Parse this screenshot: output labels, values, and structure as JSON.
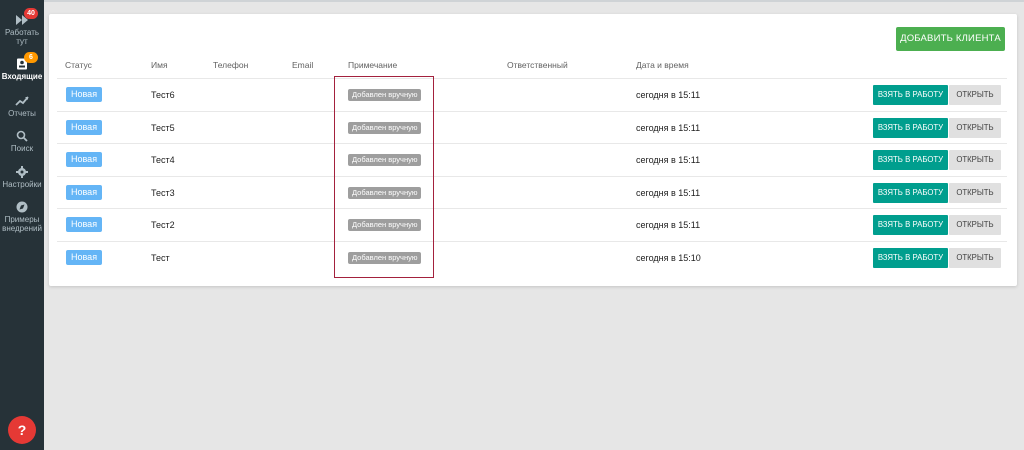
{
  "sidebar": {
    "items": [
      {
        "label": "Работать тут",
        "icon": "fast-forward-icon",
        "badge": "40",
        "badge_color": "#e53935"
      },
      {
        "label": "Входящие",
        "icon": "inbox-icon",
        "badge": "6",
        "badge_color": "#ff9800",
        "active": true
      },
      {
        "label": "Отчеты",
        "icon": "trending-up-icon"
      },
      {
        "label": "Поиск",
        "icon": "search-icon"
      },
      {
        "label": "Настройки",
        "icon": "gear-icon"
      },
      {
        "label": "Примеры внедрений",
        "icon": "compass-icon"
      }
    ],
    "help_label": "?"
  },
  "main": {
    "add_client_label": "ДОБАВИТЬ КЛИЕНТА",
    "columns": [
      "Статус",
      "Имя",
      "Телефон",
      "Email",
      "Примечание",
      "Ответственный",
      "Дата и время"
    ],
    "rows": [
      {
        "status": "Новая",
        "name": "Тест6",
        "phone": "",
        "email": "",
        "note": "Добавлен вручную",
        "owner": "",
        "datetime": "сегодня в 15:11"
      },
      {
        "status": "Новая",
        "name": "Тест5",
        "phone": "",
        "email": "",
        "note": "Добавлен вручную",
        "owner": "",
        "datetime": "сегодня в 15:11"
      },
      {
        "status": "Новая",
        "name": "Тест4",
        "phone": "",
        "email": "",
        "note": "Добавлен вручную",
        "owner": "",
        "datetime": "сегодня в 15:11"
      },
      {
        "status": "Новая",
        "name": "Тест3",
        "phone": "",
        "email": "",
        "note": "Добавлен вручную",
        "owner": "",
        "datetime": "сегодня в 15:11"
      },
      {
        "status": "Новая",
        "name": "Тест2",
        "phone": "",
        "email": "",
        "note": "Добавлен вручную",
        "owner": "",
        "datetime": "сегодня в 15:11"
      },
      {
        "status": "Новая",
        "name": "Тест",
        "phone": "",
        "email": "",
        "note": "Добавлен вручную",
        "owner": "",
        "datetime": "сегодня в 15:10"
      }
    ],
    "take_label": "ВЗЯТЬ В РАБОТУ",
    "open_label": "ОТКРЫТЬ"
  },
  "colors": {
    "sidebar_bg": "#263238",
    "accent_green": "#4caf50",
    "take_button": "#009e8e",
    "status_blue": "#64b5f6",
    "note_gray": "#9e9e9e",
    "highlight_border": "#a3213d",
    "help_red": "#e53935"
  }
}
